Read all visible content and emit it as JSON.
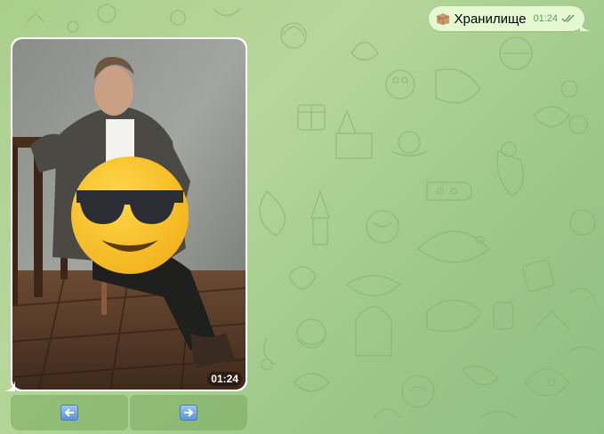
{
  "chat": {
    "outgoing_message": {
      "icon": "package-icon",
      "text": "Хранилище",
      "time": "01:24",
      "status": "read"
    },
    "photo_message": {
      "time": "01:24"
    },
    "inline_keyboard": [
      {
        "label": "⬅️",
        "icon": "left-arrow-key-icon"
      },
      {
        "label": "➡️",
        "icon": "right-arrow-key-icon"
      }
    ]
  },
  "colors": {
    "wallpaper": "#a9cf8c",
    "outgoing_bubble": "#e6f8d2",
    "time_green": "#5aa254",
    "keyboard_button": "#8fbd70",
    "arrow_key_blue": "#5b92d3"
  }
}
